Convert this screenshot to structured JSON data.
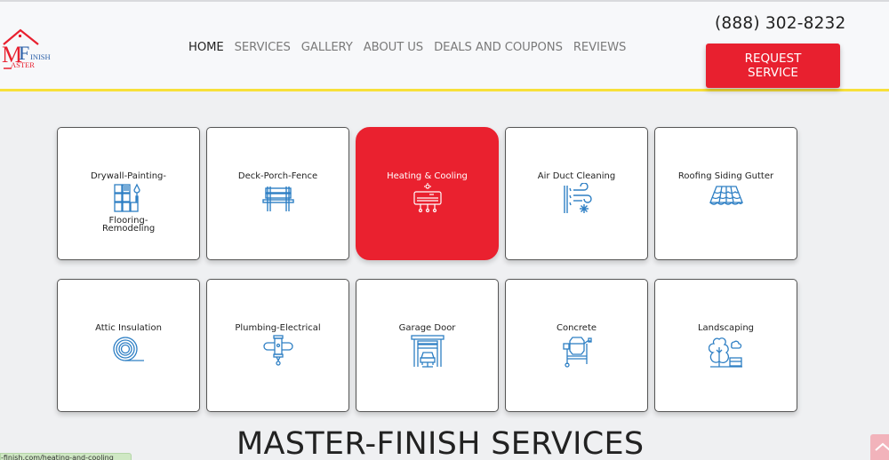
{
  "brand": {
    "logo_alt": "Master Finish",
    "logo_letters": {
      "m": "M",
      "f": "F",
      "inish": "INISH",
      "aster": "ASTER"
    },
    "colors": {
      "red": "#e8202f",
      "blue": "#2a5fa8",
      "yellow": "#f7e03a",
      "icon_blue": "#2e7fc4"
    }
  },
  "nav": {
    "items": [
      {
        "label": "HOME",
        "active": true
      },
      {
        "label": "SERVICES",
        "active": false
      },
      {
        "label": "GALLERY",
        "active": false
      },
      {
        "label": "ABOUT US",
        "active": false
      },
      {
        "label": "DEALS AND COUPONS",
        "active": false
      },
      {
        "label": "REVIEWS",
        "active": false
      }
    ]
  },
  "header": {
    "phone": "(888) 302-8232",
    "request_button_line1": "REQUEST",
    "request_button_line2": "SERVICE"
  },
  "services": [
    {
      "label": "Drywall-Painting-",
      "label_after": "Flooring-Remodeling",
      "icon": "drywall-painting-icon",
      "active": false
    },
    {
      "label": "Deck-Porch-Fence",
      "icon": "bench-icon",
      "active": false
    },
    {
      "label": "Heating & Cooling",
      "icon": "air-conditioner-icon",
      "active": true
    },
    {
      "label": "Air Duct Cleaning",
      "icon": "air-duct-icon",
      "active": false
    },
    {
      "label": "Roofing Siding Gutter",
      "icon": "roof-tiles-icon",
      "active": false
    },
    {
      "label": "Attic Insulation",
      "icon": "insulation-roll-icon",
      "active": false
    },
    {
      "label": "Plumbing-Electrical",
      "icon": "pipe-icon",
      "active": false
    },
    {
      "label": "Garage Door",
      "icon": "garage-icon",
      "active": false
    },
    {
      "label": "Concrete",
      "icon": "cement-mixer-icon",
      "active": false
    },
    {
      "label": "Landscaping",
      "icon": "tree-icon",
      "active": false
    }
  ],
  "section": {
    "title": "MASTER-FINISH SERVICES"
  },
  "status_bar": {
    "url_text": "-finish.com/heating-and-cooling"
  },
  "scroll_top": {
    "icon": "chevron-up-icon"
  }
}
